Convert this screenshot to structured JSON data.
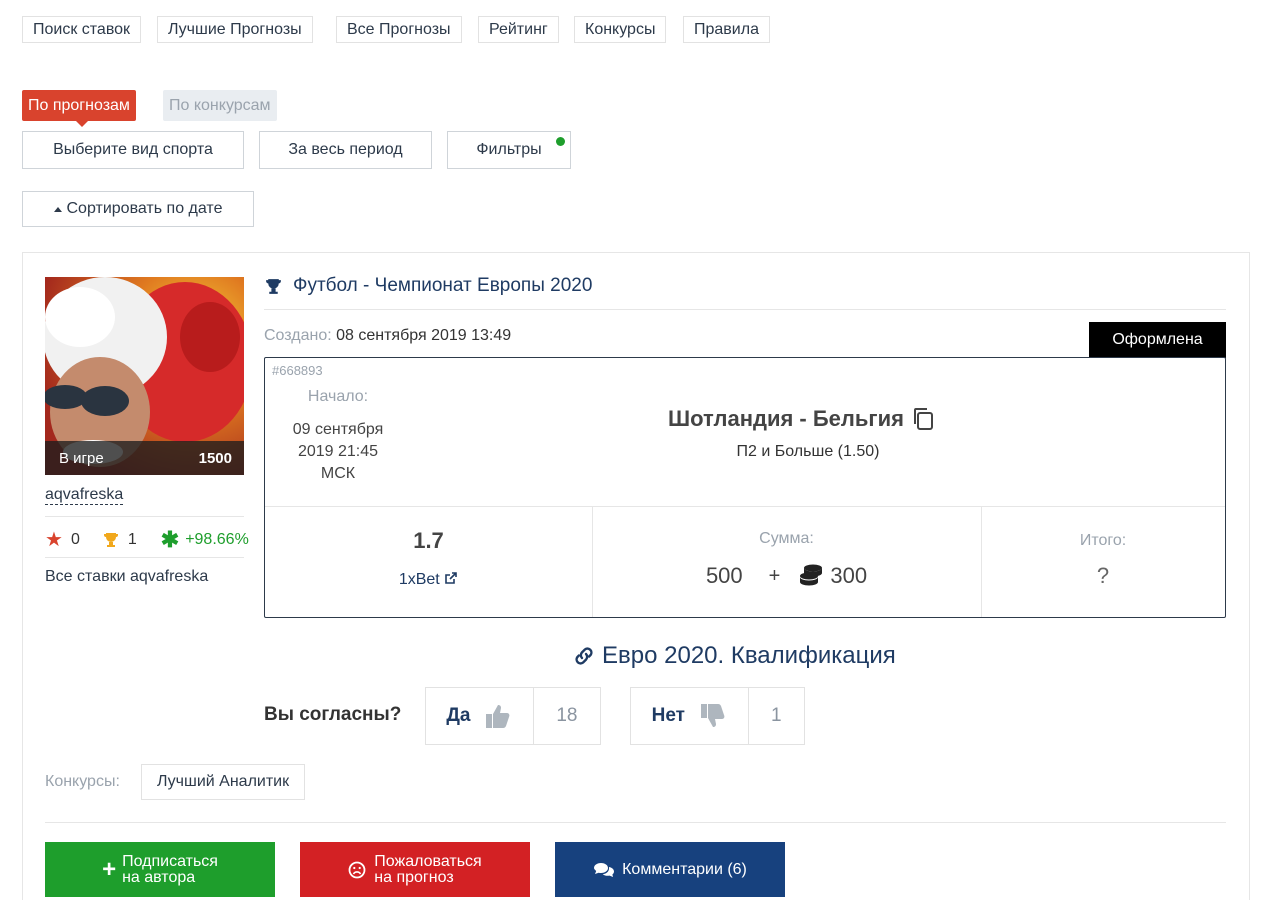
{
  "topnav": [
    "Поиск ставок",
    "Лучшие Прогнозы",
    "Все Прогнозы",
    "Рейтинг",
    "Конкурсы",
    "Правила"
  ],
  "tabs": {
    "active": "По прогнозам",
    "inactive": "По конкурсам"
  },
  "filters": {
    "sport": "Выберите вид спорта",
    "period": "За весь период",
    "filters": "Фильтры"
  },
  "sort": {
    "label": "Сортировать по дате"
  },
  "user": {
    "status": "В игре",
    "points": "1500",
    "name": "aqvafreska",
    "stars": "0",
    "trophies": "1",
    "roi": "+98.66%",
    "all_bets": "Все ставки aqvafreska"
  },
  "event": {
    "title": "Футбол - Чемпионат Европы 2020",
    "created_label": "Создано:",
    "created": "08 сентября 2019 13:49",
    "badge": "Оформлена",
    "id": "#668893",
    "start_label": "Начало:",
    "start_line1": "09 сентября",
    "start_line2": "2019 21:45",
    "start_line3": "МСК",
    "match": "Шотландия - Бельгия",
    "pick": "П2 и Больше (1.50)",
    "odds": "1.7",
    "bookmaker": "1xBet",
    "sum_label": "Сумма:",
    "sum_value": "500",
    "plus": "+",
    "bonus": "300",
    "total_label": "Итого:",
    "total_value": "?"
  },
  "link": {
    "text": "Евро 2020. Квалификация"
  },
  "vote": {
    "question": "Вы согласны?",
    "yes": "Да",
    "yes_count": "18",
    "no": "Нет",
    "no_count": "1"
  },
  "contests": {
    "label": "Конкурсы:",
    "tag": "Лучший Аналитик"
  },
  "actions": {
    "subscribe_line1": "Подписаться",
    "subscribe_line2": "на автора",
    "report_line1": "Пожаловаться",
    "report_line2": "на прогноз",
    "comments": "Комментарии (6)"
  },
  "colors": {
    "red": "#d9432d",
    "green": "#1e9e2c",
    "report": "#d32124",
    "navy": "#17417e",
    "text_dark": "#2d3a4a"
  }
}
